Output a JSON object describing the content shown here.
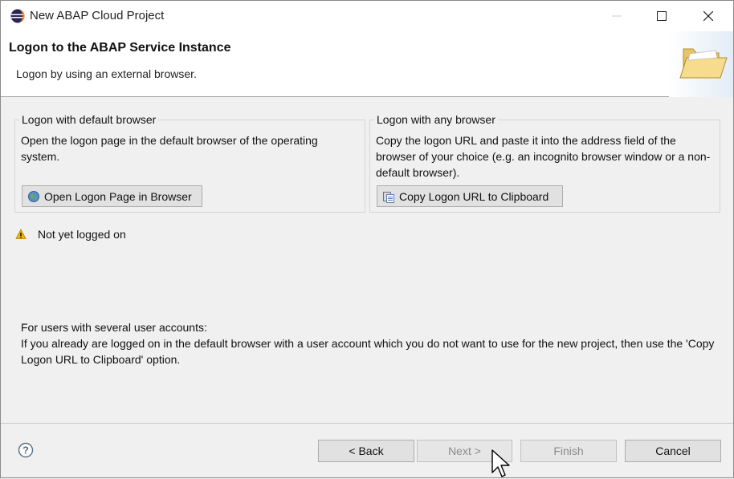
{
  "window": {
    "title": "New ABAP Cloud Project",
    "controls": {
      "minimize": "minimize-icon",
      "maximize": "maximize-icon",
      "close": "close-icon"
    }
  },
  "header": {
    "title": "Logon to the ABAP Service Instance",
    "description": "Logon by using an external browser.",
    "icon": "folder-icon"
  },
  "default_browser": {
    "legend": "Logon with default browser",
    "text": "Open the logon page in the default browser of the operating system.",
    "button_label": "Open Logon Page in Browser",
    "button_icon": "globe-icon"
  },
  "any_browser": {
    "legend": "Logon with any browser",
    "text": "Copy the logon URL and paste it into the address field of the browser of your choice (e.g. an incognito browser window or a non-default browser).",
    "button_label": "Copy Logon URL to Clipboard",
    "button_icon": "clipboard-icon"
  },
  "status": {
    "icon": "warning-icon",
    "text": "Not yet logged on"
  },
  "note": {
    "line1": "For users with several user accounts:",
    "line2": "If you already are logged on in the default browser with a user account which you do not want to use for the new project, then use the 'Copy Logon URL to Clipboard' option."
  },
  "footer": {
    "help_icon": "help-icon",
    "back_label": "< Back",
    "next_label": "Next >",
    "finish_label": "Finish",
    "cancel_label": "Cancel"
  },
  "colors": {
    "background": "#f0f0f0",
    "header_background": "#ffffff",
    "button_face": "#e1e1e1",
    "disabled_text": "#8a8a8a",
    "warning": "#e0a800"
  }
}
